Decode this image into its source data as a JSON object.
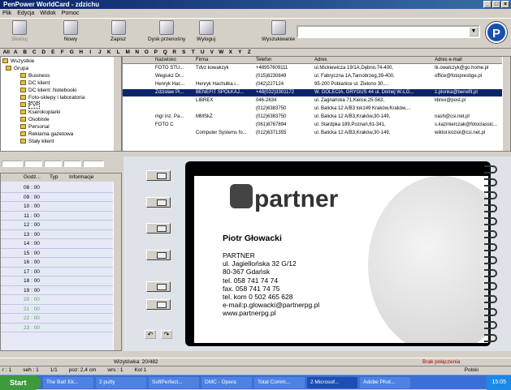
{
  "window": {
    "title": "PenPower WorldCard - zdzichu"
  },
  "menu": [
    "Plik",
    "Edycja",
    "Widok",
    "Pomoc"
  ],
  "toolbar": {
    "skanuj": "Skanuj",
    "nowy": "Nowy",
    "zapisz": "Zapisz",
    "dysk": "Dysk przenośny",
    "wyloguj": "Wyloguj",
    "wyszukiwanie": "Wyszukiwanie"
  },
  "alphabet": [
    "All",
    "A",
    "B",
    "C",
    "D",
    "E",
    "F",
    "G",
    "H",
    "I",
    "J",
    "K",
    "L",
    "M",
    "N",
    "O",
    "P",
    "Q",
    "R",
    "S",
    "T",
    "U",
    "V",
    "W",
    "X",
    "Y",
    "Z"
  ],
  "tree": {
    "root": "Wszystkie",
    "group": "Grupa",
    "items": [
      "Business",
      "DC klient",
      "DC klient: Notebooki",
      "Foto-sklepy i laboratoria",
      "FVF",
      "Kserokopiarki",
      "Osobiste",
      "Personal",
      "Reklama gazetowa",
      "Stały klient"
    ]
  },
  "grid": {
    "headers": [
      "Nazwisko",
      "Firma",
      "Telefon",
      "Adres",
      "Adres e-mail"
    ],
    "rows": [
      [
        "FOTO STU...",
        "Tdvz kowakzyk",
        "+48957609111",
        "ul.Mickiewicza 19/1A,Dębno,74-400,",
        "tk.owalczyk@go.home.pl"
      ],
      [
        "Wegiukz Dr...",
        "",
        "(015)8230849",
        "ul. Fabryczna 1A,Tarnobrzeg,39-400,",
        "office@fotoprestige.pl"
      ],
      [
        "Henryk Hac...",
        "Henryk Hachułka i...",
        "(042)227124",
        "95-200 Pobianice ul. Zielono 30,...",
        ""
      ],
      [
        "Zdzisław Pi...",
        "BENEFIT SPÓŁKAJ...",
        "+48(032)3301172",
        "W. GOLECIA, GRYGUŚ 44 ul. Dolnej W.s,G...",
        "z.plonka@benefit.pl"
      ],
      [
        "",
        "LIBREX",
        "046-2634",
        "ul. Zagnańska 71,Kielce,25-563,",
        "librex@post.pl"
      ],
      [
        "",
        "",
        "(012)6383750",
        "ul. Balicka 12 A/B3 lok149 Kraków,Kraków,...",
        ""
      ],
      [
        "mgr inz. Pa...",
        "MMSkZ",
        "(012)6383750",
        "ul. Balicka 12 A/B3,Kraków,30-149,",
        "nash@csi.net.pl"
      ],
      [
        "FOTO C",
        "",
        "(061)8767894",
        "ul. Stardpka 189,Poznań,61-341,",
        "s.kazmierczak@fotoclassic..."
      ],
      [
        "",
        "Computer Systems fo...",
        "(012)6371355",
        "ul. Balicka 12 A/B3,Kraków,30-149,",
        "wiktor.koziol@csi.net.pl"
      ]
    ]
  },
  "schedule": {
    "headers": [
      "Godz...",
      "Typ",
      "Informacje"
    ],
    "times": [
      "08 : 00",
      "09 : 00",
      "10 : 00",
      "11 : 00",
      "12 : 00",
      "13 : 00",
      "14 : 00",
      "15 : 00",
      "16 : 00",
      "17 : 00",
      "18 : 00",
      "19 : 00",
      "20 : 00",
      "21 : 00",
      "22 : 00",
      "23 : 00"
    ]
  },
  "card": {
    "brand": "partner",
    "name": "Piotr Głowacki",
    "lines": [
      "PARTNER",
      "ul. Jagiellońska 32 G/12",
      "80-367 Gdańsk",
      "tel. 058 741 74 74",
      "fax. 058 741 74 75",
      "tel. kom 0 502 465 628",
      "e-mail:p.glowacki@partnerpg.pl",
      "www.partnerpg.pl"
    ]
  },
  "status": {
    "records": "Wizytówka: 20/482",
    "connection": "Brak połączenia",
    "bottom": [
      "r : 1",
      "seh : 1",
      "1/1",
      "poz: 2,4 cm",
      "wrs : 1",
      "Kol 1"
    ],
    "lang": "Polski"
  },
  "taskbar": {
    "start": "Start",
    "tasks": [
      "The Bat! Ek...",
      "2 putty",
      "SoftPerfect...",
      "DMC - Opera",
      "Total Comm...",
      "2 Microsof...",
      "Adobe Phot..."
    ],
    "clock": "15:05"
  }
}
